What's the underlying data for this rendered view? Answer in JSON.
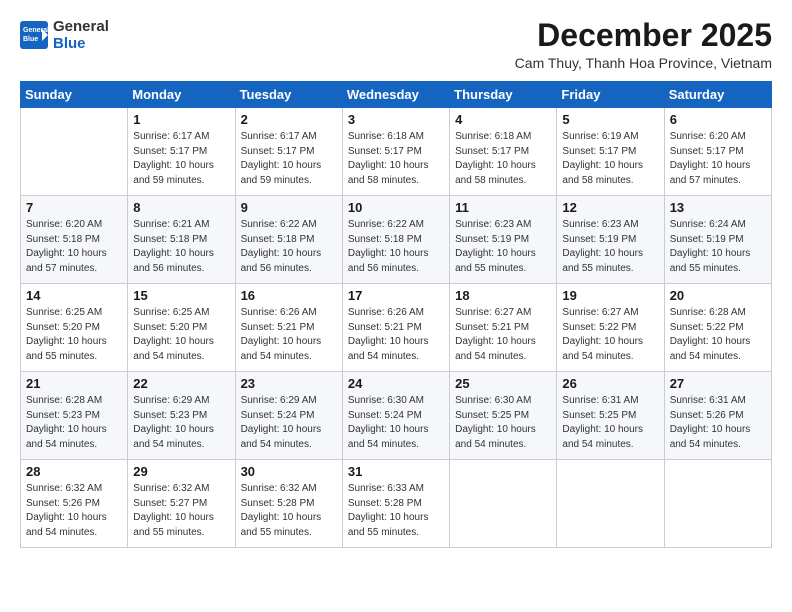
{
  "logo": {
    "general": "General",
    "blue": "Blue"
  },
  "title": "December 2025",
  "subtitle": "Cam Thuy, Thanh Hoa Province, Vietnam",
  "header": {
    "days": [
      "Sunday",
      "Monday",
      "Tuesday",
      "Wednesday",
      "Thursday",
      "Friday",
      "Saturday"
    ]
  },
  "weeks": [
    {
      "cells": [
        {
          "day": "",
          "info": ""
        },
        {
          "day": "1",
          "info": "Sunrise: 6:17 AM\nSunset: 5:17 PM\nDaylight: 10 hours\nand 59 minutes."
        },
        {
          "day": "2",
          "info": "Sunrise: 6:17 AM\nSunset: 5:17 PM\nDaylight: 10 hours\nand 59 minutes."
        },
        {
          "day": "3",
          "info": "Sunrise: 6:18 AM\nSunset: 5:17 PM\nDaylight: 10 hours\nand 58 minutes."
        },
        {
          "day": "4",
          "info": "Sunrise: 6:18 AM\nSunset: 5:17 PM\nDaylight: 10 hours\nand 58 minutes."
        },
        {
          "day": "5",
          "info": "Sunrise: 6:19 AM\nSunset: 5:17 PM\nDaylight: 10 hours\nand 58 minutes."
        },
        {
          "day": "6",
          "info": "Sunrise: 6:20 AM\nSunset: 5:17 PM\nDaylight: 10 hours\nand 57 minutes."
        }
      ]
    },
    {
      "cells": [
        {
          "day": "7",
          "info": "Sunrise: 6:20 AM\nSunset: 5:18 PM\nDaylight: 10 hours\nand 57 minutes."
        },
        {
          "day": "8",
          "info": "Sunrise: 6:21 AM\nSunset: 5:18 PM\nDaylight: 10 hours\nand 56 minutes."
        },
        {
          "day": "9",
          "info": "Sunrise: 6:22 AM\nSunset: 5:18 PM\nDaylight: 10 hours\nand 56 minutes."
        },
        {
          "day": "10",
          "info": "Sunrise: 6:22 AM\nSunset: 5:18 PM\nDaylight: 10 hours\nand 56 minutes."
        },
        {
          "day": "11",
          "info": "Sunrise: 6:23 AM\nSunset: 5:19 PM\nDaylight: 10 hours\nand 55 minutes."
        },
        {
          "day": "12",
          "info": "Sunrise: 6:23 AM\nSunset: 5:19 PM\nDaylight: 10 hours\nand 55 minutes."
        },
        {
          "day": "13",
          "info": "Sunrise: 6:24 AM\nSunset: 5:19 PM\nDaylight: 10 hours\nand 55 minutes."
        }
      ]
    },
    {
      "cells": [
        {
          "day": "14",
          "info": "Sunrise: 6:25 AM\nSunset: 5:20 PM\nDaylight: 10 hours\nand 55 minutes."
        },
        {
          "day": "15",
          "info": "Sunrise: 6:25 AM\nSunset: 5:20 PM\nDaylight: 10 hours\nand 54 minutes."
        },
        {
          "day": "16",
          "info": "Sunrise: 6:26 AM\nSunset: 5:21 PM\nDaylight: 10 hours\nand 54 minutes."
        },
        {
          "day": "17",
          "info": "Sunrise: 6:26 AM\nSunset: 5:21 PM\nDaylight: 10 hours\nand 54 minutes."
        },
        {
          "day": "18",
          "info": "Sunrise: 6:27 AM\nSunset: 5:21 PM\nDaylight: 10 hours\nand 54 minutes."
        },
        {
          "day": "19",
          "info": "Sunrise: 6:27 AM\nSunset: 5:22 PM\nDaylight: 10 hours\nand 54 minutes."
        },
        {
          "day": "20",
          "info": "Sunrise: 6:28 AM\nSunset: 5:22 PM\nDaylight: 10 hours\nand 54 minutes."
        }
      ]
    },
    {
      "cells": [
        {
          "day": "21",
          "info": "Sunrise: 6:28 AM\nSunset: 5:23 PM\nDaylight: 10 hours\nand 54 minutes."
        },
        {
          "day": "22",
          "info": "Sunrise: 6:29 AM\nSunset: 5:23 PM\nDaylight: 10 hours\nand 54 minutes."
        },
        {
          "day": "23",
          "info": "Sunrise: 6:29 AM\nSunset: 5:24 PM\nDaylight: 10 hours\nand 54 minutes."
        },
        {
          "day": "24",
          "info": "Sunrise: 6:30 AM\nSunset: 5:24 PM\nDaylight: 10 hours\nand 54 minutes."
        },
        {
          "day": "25",
          "info": "Sunrise: 6:30 AM\nSunset: 5:25 PM\nDaylight: 10 hours\nand 54 minutes."
        },
        {
          "day": "26",
          "info": "Sunrise: 6:31 AM\nSunset: 5:25 PM\nDaylight: 10 hours\nand 54 minutes."
        },
        {
          "day": "27",
          "info": "Sunrise: 6:31 AM\nSunset: 5:26 PM\nDaylight: 10 hours\nand 54 minutes."
        }
      ]
    },
    {
      "cells": [
        {
          "day": "28",
          "info": "Sunrise: 6:32 AM\nSunset: 5:26 PM\nDaylight: 10 hours\nand 54 minutes."
        },
        {
          "day": "29",
          "info": "Sunrise: 6:32 AM\nSunset: 5:27 PM\nDaylight: 10 hours\nand 55 minutes."
        },
        {
          "day": "30",
          "info": "Sunrise: 6:32 AM\nSunset: 5:28 PM\nDaylight: 10 hours\nand 55 minutes."
        },
        {
          "day": "31",
          "info": "Sunrise: 6:33 AM\nSunset: 5:28 PM\nDaylight: 10 hours\nand 55 minutes."
        },
        {
          "day": "",
          "info": ""
        },
        {
          "day": "",
          "info": ""
        },
        {
          "day": "",
          "info": ""
        }
      ]
    }
  ]
}
